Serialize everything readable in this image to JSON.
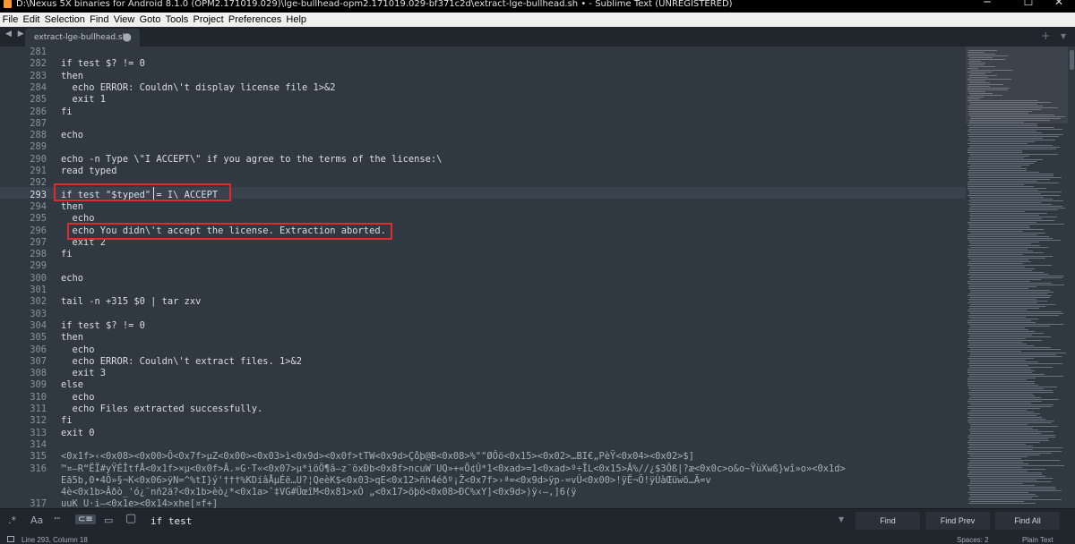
{
  "window": {
    "title": "D:\\Nexus 5X binaries for Android 8.1.0 (OPM2.171019.029)\\lge-bullhead-opm2.171019.029-bf371c2d\\extract-lge-bullhead.sh • - Sublime Text (UNREGISTERED)",
    "minimize": "─",
    "maximize": "☐",
    "close": "✕"
  },
  "menu": [
    "File",
    "Edit",
    "Selection",
    "Find",
    "View",
    "Goto",
    "Tools",
    "Project",
    "Preferences",
    "Help"
  ],
  "tabs": {
    "nav_arrows": "◀ ▶",
    "active_tab": "extract-lge-bullhead.sh",
    "dirty_marker": "●",
    "right_controls": "+ ▾"
  },
  "editor": {
    "current_line": 293,
    "lines": [
      {
        "n": "281",
        "text": ""
      },
      {
        "n": "282",
        "text": "if test $? != 0"
      },
      {
        "n": "283",
        "text": "then"
      },
      {
        "n": "284",
        "text": "  echo ERROR: Couldn\\'t display license file 1>&2"
      },
      {
        "n": "285",
        "text": "  exit 1"
      },
      {
        "n": "286",
        "text": "fi"
      },
      {
        "n": "287",
        "text": ""
      },
      {
        "n": "288",
        "text": "echo"
      },
      {
        "n": "289",
        "text": ""
      },
      {
        "n": "290",
        "text": "echo -n Type \\\"I ACCEPT\\\" if you agree to the terms of the license:\\"
      },
      {
        "n": "291",
        "text": "read typed"
      },
      {
        "n": "292",
        "text": ""
      },
      {
        "n": "293",
        "text": "if test \"$typed\" = I\\ ACCEPT"
      },
      {
        "n": "294",
        "text": "then"
      },
      {
        "n": "295",
        "text": "  echo"
      },
      {
        "n": "296",
        "text": "  echo You didn\\'t accept the license. Extraction aborted."
      },
      {
        "n": "297",
        "text": "  exit 2"
      },
      {
        "n": "298",
        "text": "fi"
      },
      {
        "n": "299",
        "text": ""
      },
      {
        "n": "300",
        "text": "echo"
      },
      {
        "n": "301",
        "text": ""
      },
      {
        "n": "302",
        "text": "tail -n +315 $0 | tar zxv"
      },
      {
        "n": "303",
        "text": ""
      },
      {
        "n": "304",
        "text": "if test $? != 0"
      },
      {
        "n": "305",
        "text": "then"
      },
      {
        "n": "306",
        "text": "  echo"
      },
      {
        "n": "307",
        "text": "  echo ERROR: Couldn\\'t extract files. 1>&2"
      },
      {
        "n": "308",
        "text": "  exit 3"
      },
      {
        "n": "309",
        "text": "else"
      },
      {
        "n": "310",
        "text": "  echo"
      },
      {
        "n": "311",
        "text": "  echo Files extracted successfully."
      },
      {
        "n": "312",
        "text": "fi"
      },
      {
        "n": "313",
        "text": "exit 0"
      },
      {
        "n": "314",
        "text": ""
      },
      {
        "n": "315",
        "text": "<0x1f>‹<0x08><0x00>Ô<0x7f>µZ<0x00><0x03>ì<0x9d><0x0f>tTW<0x9d>Ço̊þ@B<0x08>%\"\"ØÔö<0x15><0x02>…BI€„PèŸ<0x04><0x02>$]"
      },
      {
        "n": "316",
        "text": "™¤–R“ËÏ#yŸÉÎtfÅ<0x1f>×µ<0x0f>Â.»G·T«<0x07>µ*ìöÖ¶â–z¨öxÐb<0x8f>ncuW¨UQ»+«Ö¢Û*1<0xad>=1<0xad>º÷ÏL<0x15>Â%//¿$3Ôß|?æ<0x0c>o&o~ŸùXwß}wî»o»<0x1d>"
      },
      {
        "n": "",
        "text": "Eã5b,0•4Ô»§¬K<0x06>ÿN=^%tI}ý'†††%KDíâÅµÉë…U?¦QeèK$<0x03>qE<0x12>ñh4éðº¡Ž<0x7f>›ª=<0x9d>ÿp-=vÛ<0x00>!ÿË¬Ö!ÿÙàŒüwõ…Ã=v"
      },
      {
        "n": "",
        "text": "4è<0x1b>Âðò_'ó¿¨nñ2ä?<0x1b>èò¿*<0x1a>ˆ‡VG#ÜœîM<0x81>xÒ „<0x17>õþö<0x08>ÐC%xY]<0x9d>)ÿ‹—,]6(ÿ"
      },
      {
        "n": "317",
        "text": "uuK U·i–<0x1e><0x14>xhe[¤f+]"
      }
    ]
  },
  "find": {
    "regex": ".*",
    "case": "Aa",
    "whole_word": "\"\"",
    "wrap": "⊂≡",
    "in_selection": "▭",
    "highlight": "▢",
    "query": "if test",
    "history_arrow": "▼",
    "find_label": "Find",
    "find_prev_label": "Find Prev",
    "find_all_label": "Find All"
  },
  "status": {
    "position": "Line 293, Column 18",
    "indentation": "Spaces: 2",
    "syntax": "Plain Text"
  },
  "colors": {
    "background": "#303841",
    "annotation": "#e02b2b"
  }
}
